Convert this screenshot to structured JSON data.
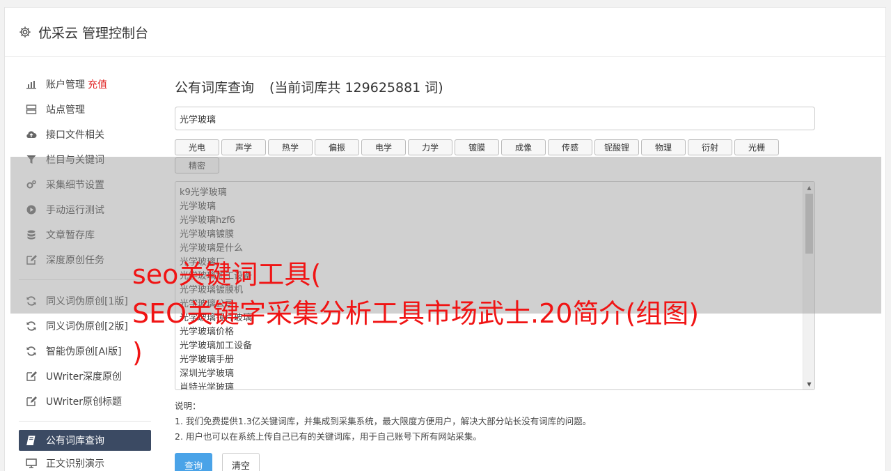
{
  "header": {
    "title": "优采云 管理控制台",
    "icon": "gear-icon"
  },
  "sidebar": {
    "group1": [
      {
        "label": "账户管理",
        "extra": "充值",
        "icon": "bar-chart-icon"
      },
      {
        "label": "站点管理",
        "icon": "server-icon"
      },
      {
        "label": "接口文件相关",
        "icon": "cloud-upload-icon"
      },
      {
        "label": "栏目与关键词",
        "icon": "filter-icon"
      },
      {
        "label": "采集细节设置",
        "icon": "gears-icon"
      },
      {
        "label": "手动运行测试",
        "icon": "play-circle-icon"
      },
      {
        "label": "文章暂存库",
        "icon": "database-icon"
      },
      {
        "label": "深度原创任务",
        "icon": "edit-icon"
      }
    ],
    "group2": [
      {
        "label": "同义词伪原创[1版]",
        "icon": "refresh-icon"
      },
      {
        "label": "同义词伪原创[2版]",
        "icon": "refresh-icon"
      },
      {
        "label": "智能伪原创[AI版]",
        "icon": "refresh-icon"
      },
      {
        "label": "UWriter深度原创",
        "icon": "edit-icon"
      },
      {
        "label": "UWriter原创标题",
        "icon": "edit-icon"
      }
    ],
    "group3": [
      {
        "label": "公有词库查询",
        "icon": "book-icon",
        "active": true
      },
      {
        "label": "正文识别演示",
        "icon": "monitor-icon"
      }
    ]
  },
  "main": {
    "title": "公有词库查询",
    "count_text": "(当前词库共 129625881 词)",
    "search_value": "光学玻璃",
    "tags": [
      "光电",
      "声学",
      "热学",
      "偏振",
      "电学",
      "力学",
      "镀膜",
      "成像",
      "传感",
      "铌酸锂",
      "物理",
      "衍射",
      "光栅",
      "精密"
    ],
    "results": [
      "k9光学玻璃",
      "光学玻璃",
      "光学玻璃hzf6",
      "光学玻璃镀膜",
      "光学玻璃是什么",
      "光学玻璃厂",
      "光学玻璃加工设备",
      "光学玻璃镀膜机",
      "光学玻璃公司",
      "光学玻璃镜片玻璃",
      "光学玻璃价格",
      "光学玻璃加工设备",
      "光学玻璃手册",
      "深圳光学玻璃",
      "肖特光学玻璃"
    ],
    "notes_title": "说明：",
    "notes": [
      "1. 我们免费提供1.3亿关键词库，并集成到采集系统，最大限度方便用户，解决大部分站长没有词库的问题。",
      "2. 用户也可以在系统上传自己已有的关键词库，用于自己账号下所有网站采集。"
    ],
    "query_button": "查询",
    "clear_button": "清空"
  },
  "watermark": {
    "text": "seo关键词工具(\nSEO关键字采集分析工具市场武士.20简介(组图)\n)"
  }
}
